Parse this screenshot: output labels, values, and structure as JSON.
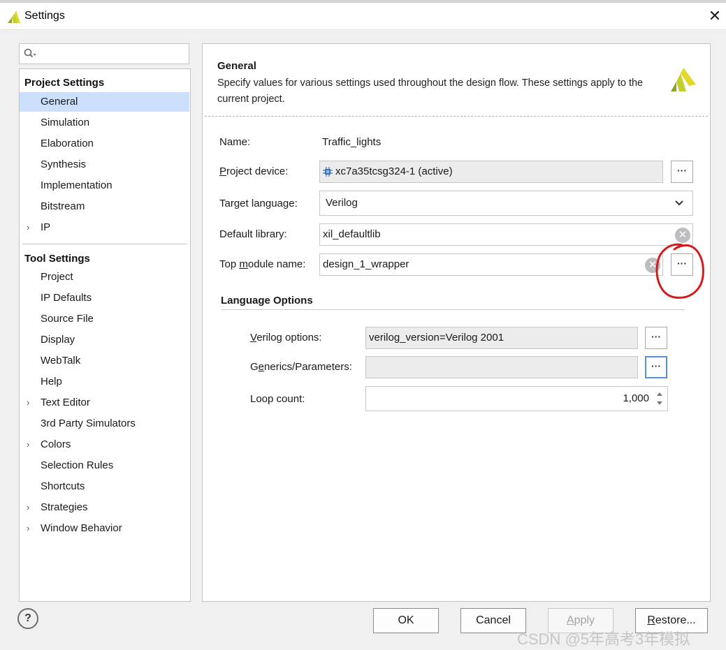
{
  "window": {
    "title": "Settings"
  },
  "search": {
    "placeholder": ""
  },
  "tree": {
    "project_settings": "Project Settings",
    "project_items": [
      {
        "label": "General",
        "selected": true,
        "expandable": false
      },
      {
        "label": "Simulation",
        "expandable": false
      },
      {
        "label": "Elaboration",
        "expandable": false
      },
      {
        "label": "Synthesis",
        "expandable": false
      },
      {
        "label": "Implementation",
        "expandable": false
      },
      {
        "label": "Bitstream",
        "expandable": false
      },
      {
        "label": "IP",
        "expandable": true
      }
    ],
    "tool_settings": "Tool Settings",
    "tool_items": [
      {
        "label": "Project",
        "expandable": false
      },
      {
        "label": "IP Defaults",
        "expandable": false
      },
      {
        "label": "Source File",
        "expandable": false
      },
      {
        "label": "Display",
        "expandable": false
      },
      {
        "label": "WebTalk",
        "expandable": false
      },
      {
        "label": "Help",
        "expandable": false
      },
      {
        "label": "Text Editor",
        "expandable": true
      },
      {
        "label": "3rd Party Simulators",
        "expandable": false
      },
      {
        "label": "Colors",
        "expandable": true
      },
      {
        "label": "Selection Rules",
        "expandable": false
      },
      {
        "label": "Shortcuts",
        "expandable": false
      },
      {
        "label": "Strategies",
        "expandable": true
      },
      {
        "label": "Window Behavior",
        "expandable": true
      }
    ]
  },
  "general": {
    "title": "General",
    "description": "Specify values for various settings used throughout the design flow. These settings apply to the current project.",
    "name_label": "Name:",
    "name_value": "Traffic_lights",
    "device_label_pre": "P",
    "device_label_rest": "roject device:",
    "device_value": "xc7a35tcsg324-1 (active)",
    "language_label": "Target language:",
    "language_value": "Verilog",
    "library_label": "Default library:",
    "library_value": "xil_defaultlib",
    "top_label_pre": "Top ",
    "top_label_u": "m",
    "top_label_rest": "odule name:",
    "top_value": "design_1_wrapper",
    "dots": "···"
  },
  "language_options": {
    "title": "Language Options",
    "verilog_label_u": "V",
    "verilog_label_rest": "erilog options:",
    "verilog_value": "verilog_version=Verilog 2001",
    "generics_label_pre": "G",
    "generics_label_u": "e",
    "generics_label_rest": "nerics/Parameters:",
    "generics_value": "",
    "loop_label": "Loop count:",
    "loop_value": "1,000"
  },
  "buttons": {
    "help": "?",
    "ok": "OK",
    "cancel": "Cancel",
    "apply_u": "A",
    "apply_rest": "pply",
    "restore_u": "R",
    "restore_rest": "estore..."
  },
  "watermark": "CSDN @5年高考3年模拟",
  "colors": {
    "selection": "#cde0fb",
    "focus_border": "#5a8fd6",
    "annotation": "#d61a1a"
  }
}
